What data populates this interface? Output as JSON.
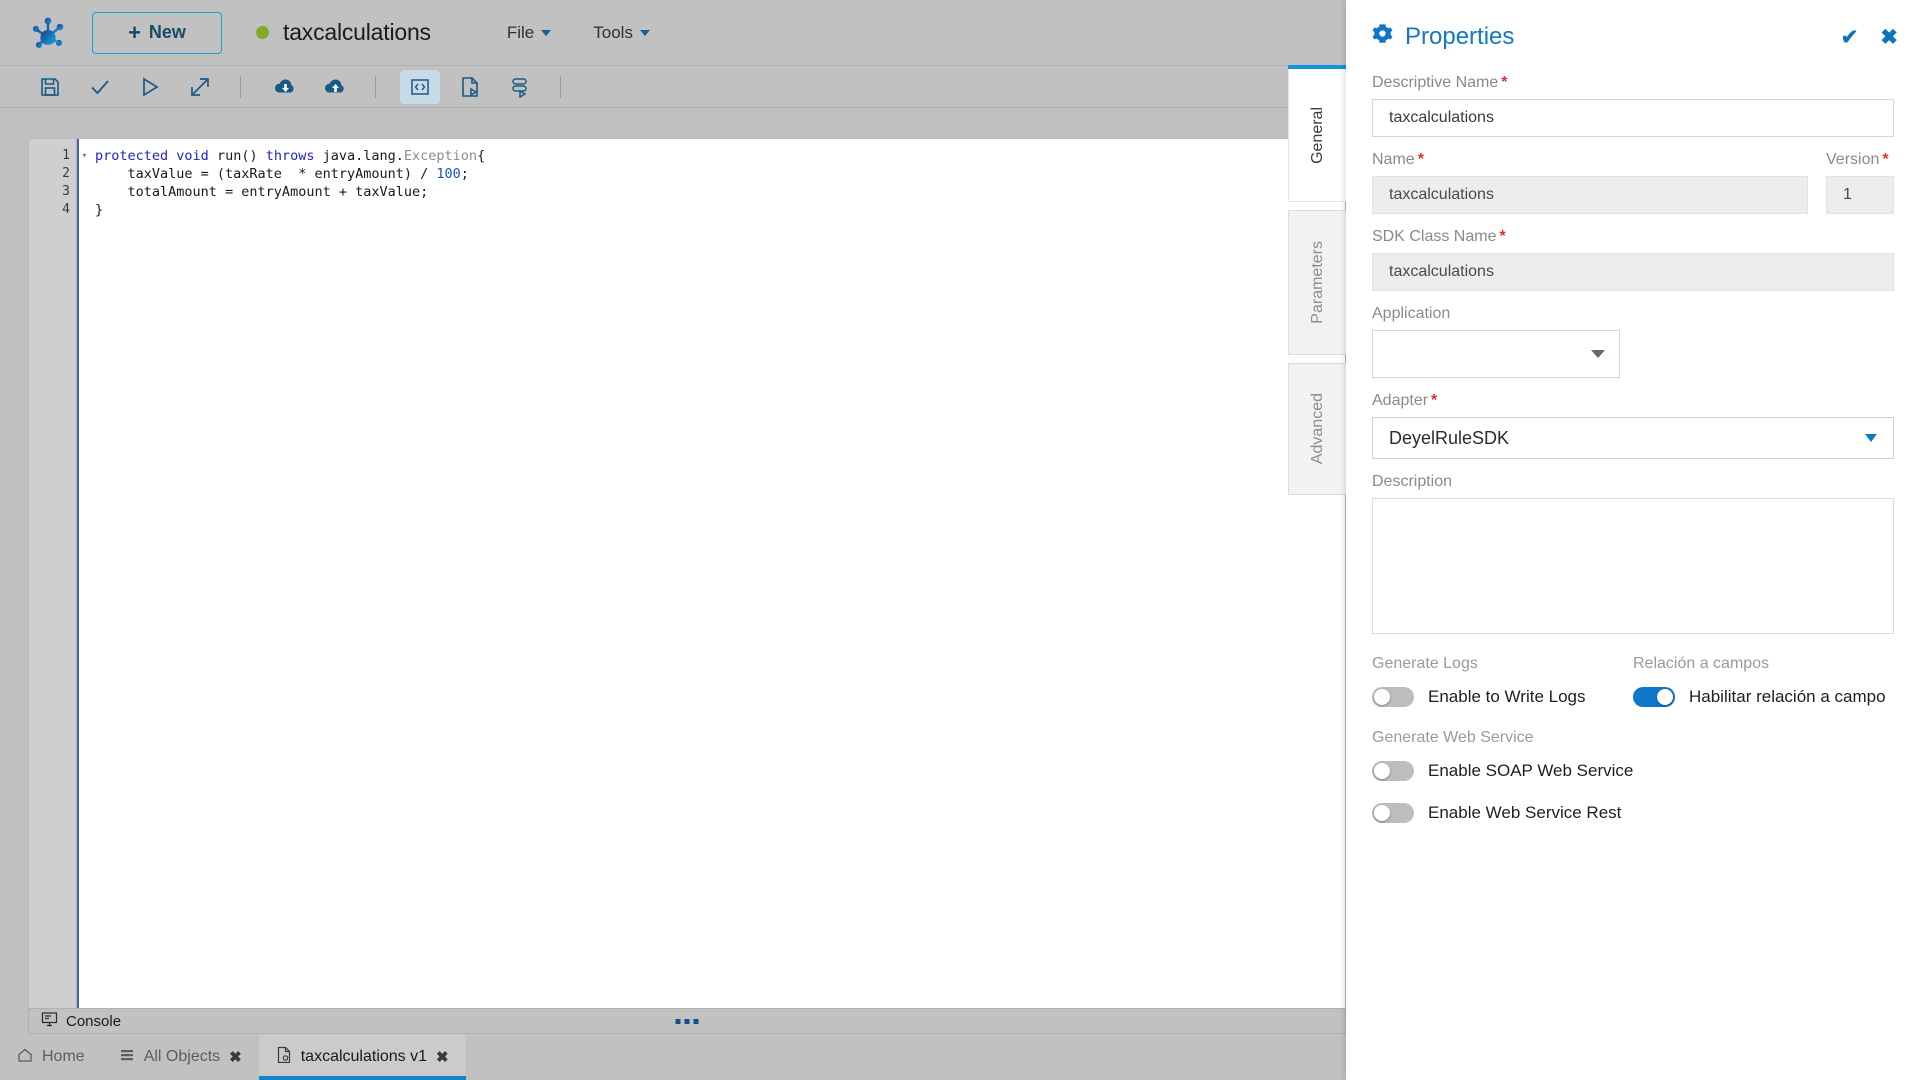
{
  "app": {
    "logo_name": "frog-foot-logo",
    "new_button": "New",
    "document_title": "taxcalculations",
    "status_color": "#84a82b"
  },
  "menus": [
    {
      "label": "File",
      "name": "menu-file"
    },
    {
      "label": "Tools",
      "name": "menu-tools"
    }
  ],
  "toolbar": {
    "icons": [
      {
        "name": "save-icon",
        "title": "Save"
      },
      {
        "name": "validate-check-icon",
        "title": "Validate"
      },
      {
        "name": "run-play-icon",
        "title": "Run"
      },
      {
        "name": "export-arrow-icon",
        "title": "Export"
      },
      {
        "name": "cloud-download-icon",
        "title": "Import"
      },
      {
        "name": "cloud-upload-icon",
        "title": "Publish"
      },
      {
        "name": "code-view-icon",
        "title": "Code"
      },
      {
        "name": "document-run-icon",
        "title": "Document"
      },
      {
        "name": "layers-icon",
        "title": "Layers"
      }
    ]
  },
  "editor": {
    "lines": [
      {
        "no": "1",
        "fold": true
      },
      {
        "no": "2",
        "fold": false
      },
      {
        "no": "3",
        "fold": false
      },
      {
        "no": "4",
        "fold": false
      }
    ],
    "line1_kw1": "protected",
    "line1_kw2": "void",
    "line1_fn": " run() ",
    "line1_kw3": "throws",
    "line1_pkg": " java.lang.",
    "line1_type": "Exception",
    "line1_brace": "{",
    "line2": "    taxValue = (taxRate  * entryAmount) / ",
    "line2_num": "100",
    "line2_end": ";",
    "line3": "    totalAmount = entryAmount + taxValue;",
    "line4": "}"
  },
  "console": {
    "label": "Console",
    "icon": "console-monitor-icon"
  },
  "bottom_tabs": [
    {
      "label": "Home",
      "icon": "home-icon",
      "closable": false,
      "active": false
    },
    {
      "label": "All Objects",
      "icon": "list-icon",
      "closable": true,
      "active": false
    },
    {
      "label": "taxcalculations v1",
      "icon": "file-rule-icon",
      "closable": true,
      "active": true
    }
  ],
  "panel": {
    "title": "Properties",
    "gear_icon": "gear-icon",
    "confirm_icon": "check-icon",
    "close_icon": "close-icon",
    "vtabs": [
      {
        "label": "General",
        "active": true
      },
      {
        "label": "Parameters",
        "active": false
      },
      {
        "label": "Advanced",
        "active": false
      }
    ],
    "fields": {
      "descriptive_name_label": "Descriptive Name",
      "descriptive_name_value": "taxcalculations",
      "name_label": "Name",
      "name_value": "taxcalculations",
      "version_label": "Version",
      "version_value": "1",
      "sdk_class_label": "SDK Class Name",
      "sdk_class_value": "taxcalculations",
      "application_label": "Application",
      "application_value": "",
      "adapter_label": "Adapter",
      "adapter_value": "DeyelRuleSDK",
      "description_label": "Description",
      "description_value": ""
    },
    "toggles": {
      "generate_logs_header": "Generate Logs",
      "relacion_header": "Relación a campos",
      "generate_ws_header": "Generate Web Service",
      "enable_logs_label": "Enable to Write Logs",
      "enable_logs_on": false,
      "habilitar_label": "Habilitar relación a campo",
      "habilitar_on": true,
      "soap_label": "Enable SOAP Web Service",
      "soap_on": false,
      "rest_label": "Enable Web Service Rest",
      "rest_on": false
    },
    "accent_color": "#0e77c8"
  }
}
